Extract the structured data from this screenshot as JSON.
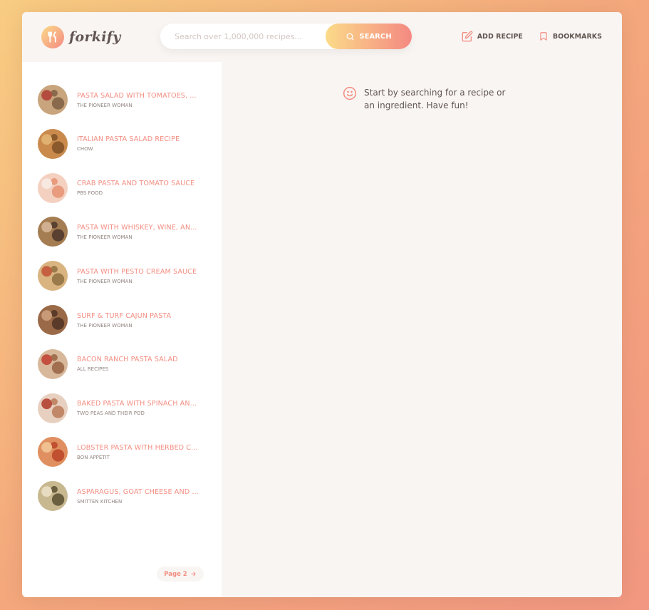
{
  "app": {
    "logo_text": "forkify"
  },
  "search": {
    "placeholder": "Search over 1,000,000 recipes...",
    "button_label": "SEARCH"
  },
  "nav": {
    "add_recipe": "ADD RECIPE",
    "bookmarks": "BOOKMARKS"
  },
  "results": [
    {
      "title": "PASTA SALAD WITH TOMATOES, ...",
      "publisher": "THE PIONEER WOMAN",
      "colors": [
        "#c9a57e",
        "#8a6a4c",
        "#b34c3f"
      ]
    },
    {
      "title": "ITALIAN PASTA SALAD RECIPE",
      "publisher": "CHOW",
      "colors": [
        "#c98a4c",
        "#8a5a2c",
        "#e0b070"
      ]
    },
    {
      "title": "CRAB PASTA AND TOMATO SAUCE",
      "publisher": "PBS FOOD",
      "colors": [
        "#f4d0c0",
        "#e89b7d",
        "#f7e8e0"
      ]
    },
    {
      "title": "PASTA WITH WHISKEY, WINE, AN...",
      "publisher": "THE PIONEER WOMAN",
      "colors": [
        "#a57d52",
        "#5a4030",
        "#d0b090"
      ]
    },
    {
      "title": "PASTA WITH PESTO CREAM SAUCE",
      "publisher": "THE PIONEER WOMAN",
      "colors": [
        "#d9b480",
        "#9a7a4a",
        "#c46040"
      ]
    },
    {
      "title": "SURF & TURF CAJUN PASTA",
      "publisher": "THE PIONEER WOMAN",
      "colors": [
        "#9a6a48",
        "#5a3a28",
        "#c89a78"
      ]
    },
    {
      "title": "BACON RANCH PASTA SALAD",
      "publisher": "ALL RECIPES",
      "colors": [
        "#d8b89a",
        "#a07050",
        "#c45040"
      ]
    },
    {
      "title": "BAKED PASTA WITH SPINACH AN...",
      "publisher": "TWO PEAS AND THEIR POD",
      "colors": [
        "#e8d0c0",
        "#c08868",
        "#b85040"
      ]
    },
    {
      "title": "LOBSTER PASTA WITH HERBED C...",
      "publisher": "BON APPETIT",
      "colors": [
        "#e09060",
        "#c05030",
        "#f0c090"
      ]
    },
    {
      "title": "ASPARAGUS, GOAT CHEESE AND ...",
      "publisher": "SMITTEN KITCHEN",
      "colors": [
        "#c8b890",
        "#6a6040",
        "#e8dcc0"
      ]
    }
  ],
  "pagination": {
    "next_label": "Page 2"
  },
  "message": {
    "text": "Start by searching for a recipe or an ingredient. Have fun!"
  },
  "colors": {
    "accent": "#f38e82",
    "gradient_start": "#fbdb89",
    "gradient_end": "#f48982",
    "text_dark": "#615551",
    "text_muted": "#918581"
  }
}
